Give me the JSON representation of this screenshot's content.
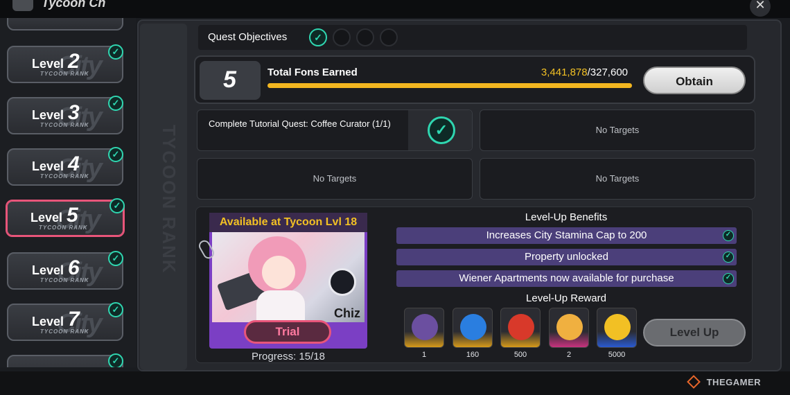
{
  "top": {
    "title": "Tycoon Ch"
  },
  "sidebar": {
    "items": [
      {
        "label": "Level",
        "num": "2",
        "rank": "TYCOON RANK",
        "done": true
      },
      {
        "label": "Level",
        "num": "3",
        "rank": "TYCOON RANK",
        "done": true
      },
      {
        "label": "Level",
        "num": "4",
        "rank": "TYCOON RANK",
        "done": true
      },
      {
        "label": "Level",
        "num": "5",
        "rank": "TYCOON RANK",
        "done": true,
        "active": true
      },
      {
        "label": "Level",
        "num": "6",
        "rank": "TYCOON RANK",
        "done": true
      },
      {
        "label": "Level",
        "num": "7",
        "rank": "TYCOON RANK",
        "done": true
      }
    ],
    "vertical_text": "TYCOON RANK"
  },
  "objectives": {
    "label": "Quest Objectives",
    "completed": 1,
    "total": 4
  },
  "quest": {
    "number": "5",
    "title": "Total Fons Earned",
    "current": "3,441,878",
    "target": "/327,600",
    "progress": 1.0,
    "obtain_label": "Obtain"
  },
  "targets": [
    {
      "text": "Complete Tutorial Quest: Coffee Curator (1/1)",
      "done": true
    },
    {
      "text": "No Targets"
    },
    {
      "text": "No Targets"
    },
    {
      "text": "No Targets"
    }
  ],
  "card": {
    "header": "Available at Tycoon Lvl 18",
    "character": "Chiz",
    "trial_label": "Trial",
    "progress": "Progress: 15/18"
  },
  "benefits": {
    "title": "Level-Up Benefits",
    "items": [
      "Increases City Stamina Cap to 200",
      "Property unlocked",
      "Wiener Apartments now available for purchase"
    ]
  },
  "rewards": {
    "title": "Level-Up Reward",
    "items": [
      {
        "qty": "1",
        "icon": "ticket-icon",
        "rarity": "gold",
        "color": "#6b4fa0"
      },
      {
        "qty": "160",
        "icon": "polychrome-icon",
        "rarity": "gold",
        "color": "#2a7ee0"
      },
      {
        "qty": "500",
        "icon": "hunter-hearts-icon",
        "rarity": "gold",
        "color": "#d8392a"
      },
      {
        "qty": "2",
        "icon": "mascot-icon",
        "rarity": "pink",
        "color": "#f0b040"
      },
      {
        "qty": "5000",
        "icon": "coin-icon",
        "rarity": "blue",
        "color": "#f2c024"
      }
    ]
  },
  "levelup_label": "Level Up",
  "watermark": "THEGAMER",
  "colors": {
    "accent": "#2fd6b0",
    "active": "#e8557a",
    "gold": "#f2c024",
    "benefit": "#4b3f7a",
    "card": "#7b3fc4"
  }
}
